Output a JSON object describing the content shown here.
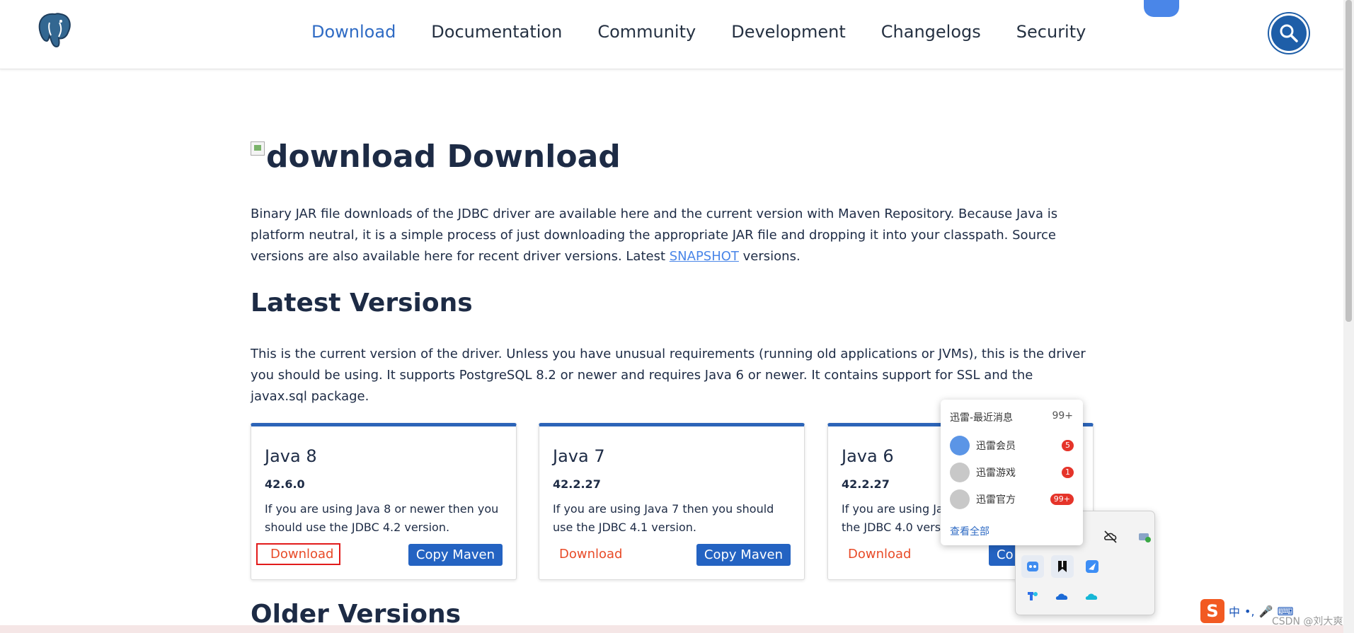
{
  "nav": {
    "items": [
      {
        "label": "Download",
        "active": true
      },
      {
        "label": "Documentation",
        "active": false
      },
      {
        "label": "Community",
        "active": false
      },
      {
        "label": "Development",
        "active": false
      },
      {
        "label": "Changelogs",
        "active": false
      },
      {
        "label": "Security",
        "active": false
      }
    ],
    "logo_icon": "postgresql-elephant-icon",
    "search_icon": "search-icon"
  },
  "page": {
    "title_img_alt": "download",
    "title": "Download",
    "intro_pre": "Binary JAR file downloads of the JDBC driver are available here and the current version with Maven Repository. Because Java is platform neutral, it is a simple process of just downloading the appropriate JAR file and dropping it into your classpath. Source versions are also available here for recent driver versions. Latest ",
    "intro_link": "SNAPSHOT",
    "intro_post": " versions.",
    "latest_heading": "Latest Versions",
    "latest_text": "This is the current version of the driver. Unless you have unusual requirements (running old applications or JVMs), this is the driver you should be using. It supports PostgreSQL 8.2 or newer and requires Java 6 or newer. It contains support for SSL and the javax.sql package.",
    "older_heading": "Older Versions"
  },
  "cards": [
    {
      "title": "Java 8",
      "version": "42.6.0",
      "desc": "If you are using Java 8 or newer then you should use the JDBC 4.2 version.",
      "download": "Download",
      "maven": "Copy Maven"
    },
    {
      "title": "Java 7",
      "version": "42.2.27",
      "desc": "If you are using Java 7 then you should use the JDBC 4.1 version.",
      "download": "Download",
      "maven": "Copy Maven"
    },
    {
      "title": "Java 6",
      "version": "42.2.27",
      "desc": "If you are using Jav",
      "desc2": "the JDBC 4.0 versi",
      "download": "Download",
      "maven": "Co"
    }
  ],
  "popup": {
    "header": "迅雷-最近消息",
    "count": "99+",
    "rows": [
      {
        "name": "迅雷会员",
        "badge": "5"
      },
      {
        "name": "迅雷游戏",
        "badge": "1"
      },
      {
        "name": "迅雷官方",
        "badge": "99+"
      }
    ],
    "more": "查看全部"
  },
  "tray": {
    "icons": [
      "cloud-off-icon",
      "network-icon",
      "chat-bot-icon",
      "bookmark-icon",
      "feather-app-icon",
      "tencent-app-icon",
      "onedrive-icon",
      "cloud-icon"
    ]
  },
  "ime": {
    "logo": "S",
    "lang": "中",
    "punct": "•,"
  },
  "watermark": "CSDN @刘大爽",
  "colors": {
    "accent": "#2f6bc4",
    "button": "#2463c2",
    "download_link": "#e84b28",
    "card_border": "#2c64b8"
  }
}
